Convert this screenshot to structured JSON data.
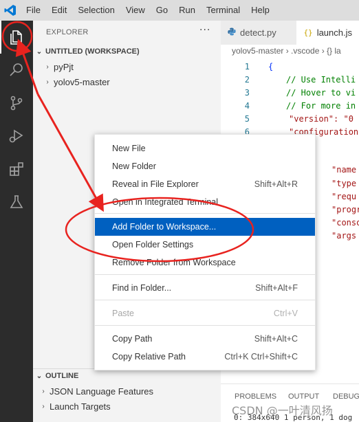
{
  "menubar": {
    "items": [
      "File",
      "Edit",
      "Selection",
      "View",
      "Go",
      "Run",
      "Terminal",
      "Help"
    ]
  },
  "activity_bar": {
    "icons": [
      "explorer-icon",
      "search-icon",
      "source-control-icon",
      "run-debug-icon",
      "extensions-icon",
      "testing-icon"
    ]
  },
  "sidebar": {
    "title": "EXPLORER",
    "more": "···",
    "workspace_header": "UNTITLED (WORKSPACE)",
    "folders": [
      "pyPjt",
      "yolov5-master"
    ],
    "outline_header": "OUTLINE",
    "outline_items": [
      "JSON Language Features",
      "Launch Targets"
    ]
  },
  "editor": {
    "tabs": [
      {
        "label": "detect.py",
        "icon": "python-icon",
        "active": false
      },
      {
        "label": "launch.js",
        "icon": "json-icon",
        "active": true
      }
    ],
    "breadcrumb": "yolov5-master › .vscode › {} la",
    "lines": [
      {
        "n": "1",
        "text": "{"
      },
      {
        "n": "2",
        "text": "// Use Intelli"
      },
      {
        "n": "3",
        "text": "// Hover to vi"
      },
      {
        "n": "4",
        "text": "// For more in"
      },
      {
        "n": "5",
        "text": "\"version\": \"0"
      },
      {
        "n": "6",
        "text": "\"configuration"
      }
    ],
    "partial_keys": [
      "\"name",
      "\"type",
      "\"requ",
      "\"progr",
      "\"conso",
      "\"args"
    ]
  },
  "context_menu": {
    "items": [
      {
        "label": "New File",
        "shortcut": ""
      },
      {
        "label": "New Folder",
        "shortcut": ""
      },
      {
        "label": "Reveal in File Explorer",
        "shortcut": "Shift+Alt+R"
      },
      {
        "label": "Open in Integrated Terminal",
        "shortcut": ""
      },
      {
        "label": "Add Folder to Workspace...",
        "shortcut": "",
        "highlighted": true
      },
      {
        "label": "Open Folder Settings",
        "shortcut": ""
      },
      {
        "label": "Remove Folder from Workspace",
        "shortcut": ""
      },
      {
        "label": "Find in Folder...",
        "shortcut": "Shift+Alt+F"
      },
      {
        "label": "Paste",
        "shortcut": "Ctrl+V",
        "disabled": true
      },
      {
        "label": "Copy Path",
        "shortcut": "Shift+Alt+C"
      },
      {
        "label": "Copy Relative Path",
        "shortcut": "Ctrl+K Ctrl+Shift+C"
      }
    ]
  },
  "panel": {
    "tabs": [
      "PROBLEMS",
      "OUTPUT",
      "DEBUG"
    ],
    "terminal_line": "0: 384x640 1 person, 1 dog"
  },
  "watermark": "CSDN @一叶清风扬",
  "colors": {
    "annotation": "#e8231f",
    "menu_highlight": "#0060c0",
    "activity_bar": "#2c2c2c",
    "vscode_blue": "#0078d4"
  }
}
